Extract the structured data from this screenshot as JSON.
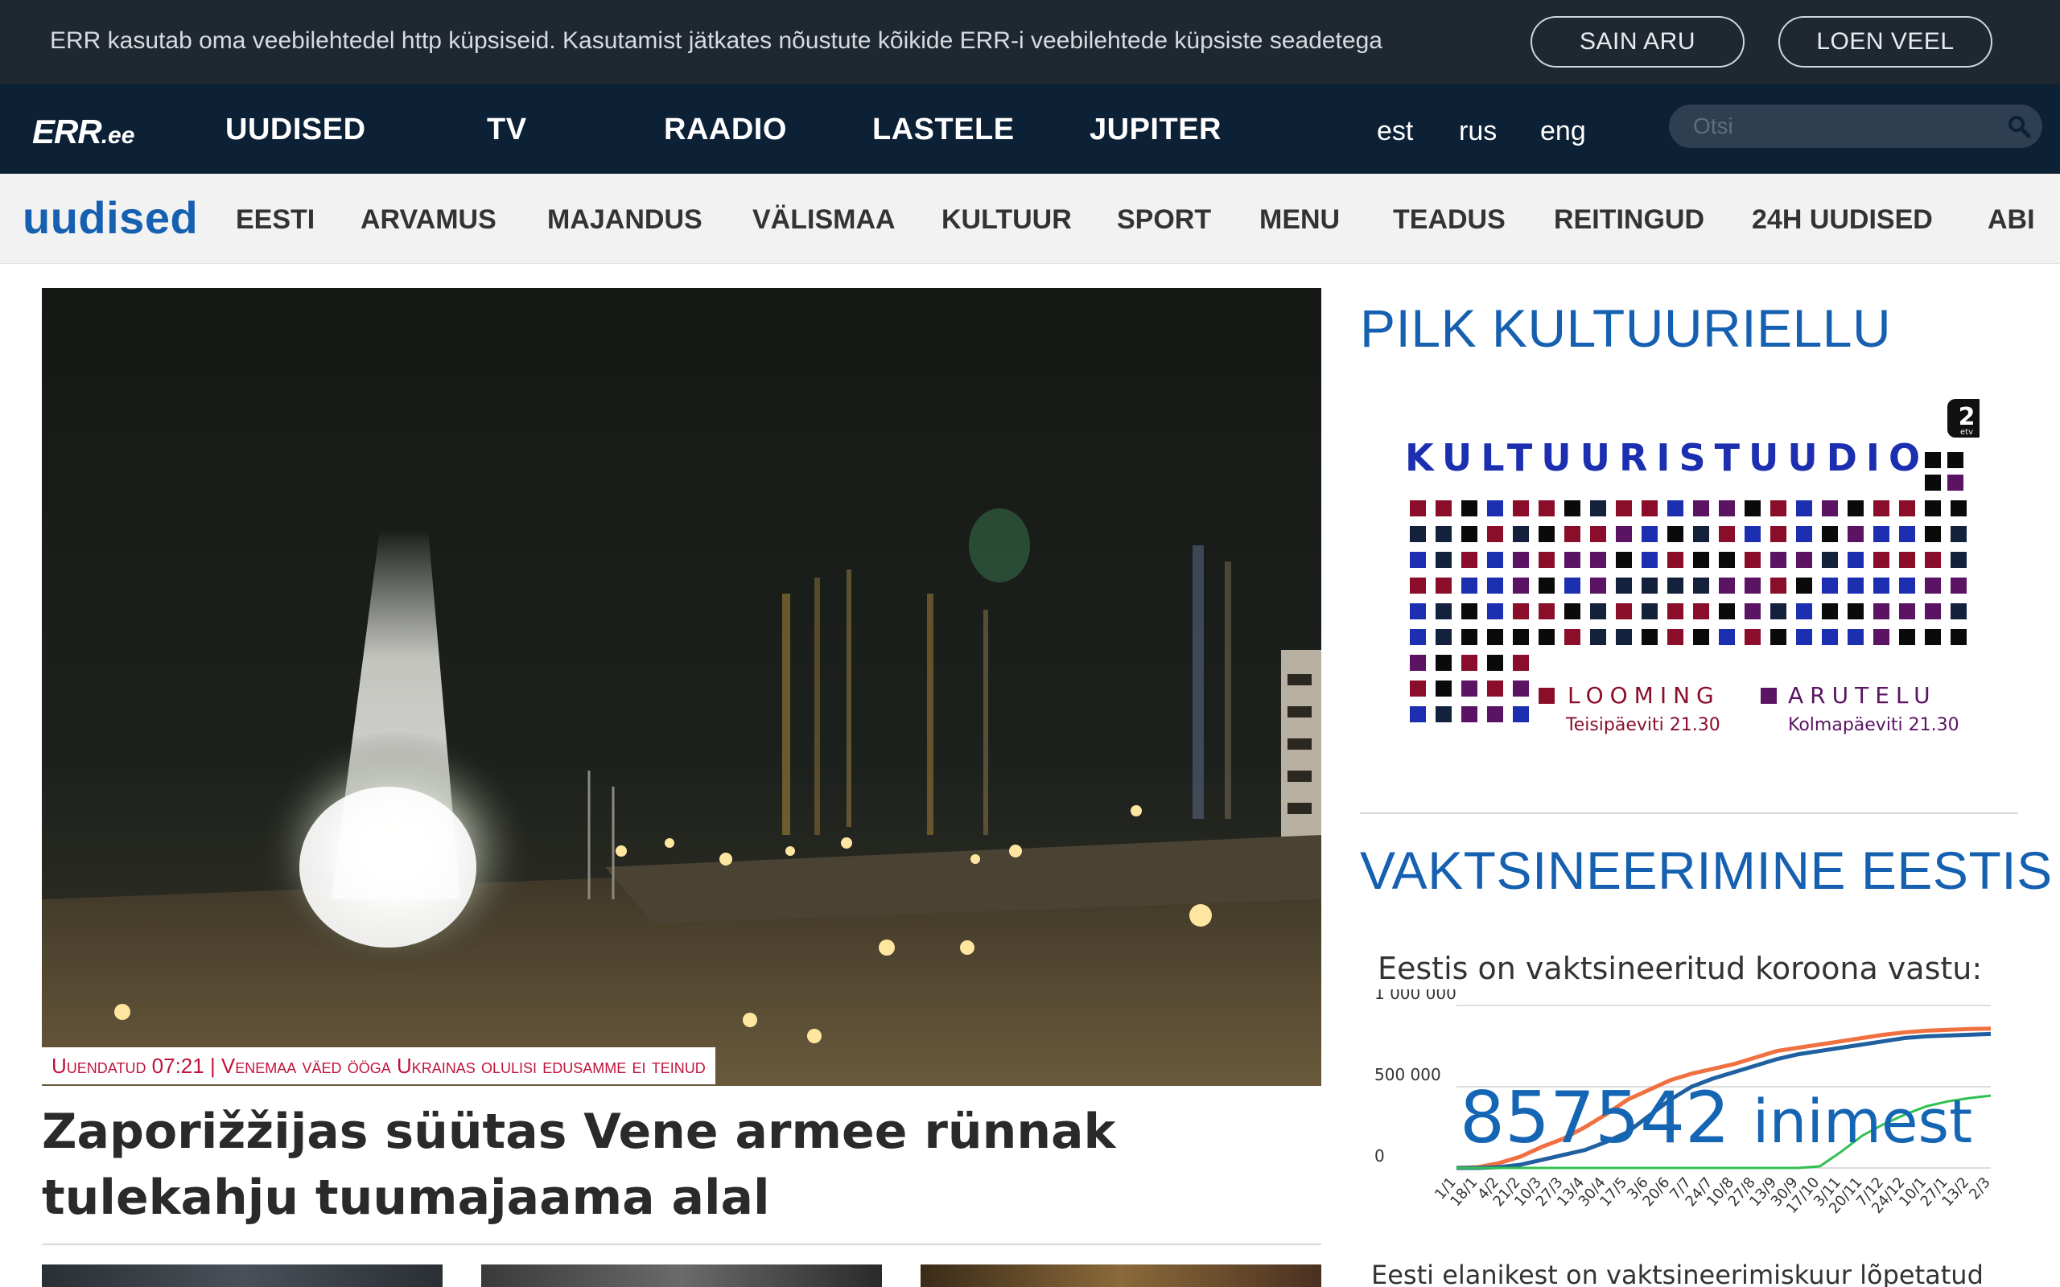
{
  "cookie_bar": {
    "text": "ERR kasutab oma veebilehtedel http küpsiseid. Kasutamist jätkates nõustute kõikide ERR-i veebilehtede küpsiste seadetega",
    "agree_label": "SAIN ARU",
    "more_label": "LOEN VEEL"
  },
  "topnav": {
    "logo_main": "ERR",
    "logo_tld": ".ee",
    "items": [
      "UUDISED",
      "TV",
      "RAADIO",
      "LASTELE",
      "JUPITER"
    ],
    "languages": [
      "est",
      "rus",
      "eng"
    ],
    "search_placeholder": "Otsi"
  },
  "section_nav": {
    "brand": "uudised",
    "items": [
      "EESTI",
      "ARVAMUS",
      "MAJANDUS",
      "VÄLISMAA",
      "KULTUUR",
      "SPORT",
      "MENU",
      "TEADUS",
      "REITINGUD",
      "24H UUDISED",
      "ABI"
    ]
  },
  "hero": {
    "caption": "Uuendatud 07:21 | Venemaa väed ööga Ukrainas olulisi edusamme ei teinud",
    "title": "Zaporižžijas süütas Vene armee rünnak tulekahju tuumajaama alal"
  },
  "sidebar": {
    "culture_heading": "PILK KULTUURIELLU",
    "promo": {
      "title": "KULTUURISTUUDIO",
      "channel": "2",
      "channel_sub": "etv",
      "left_label": "LOOMING",
      "left_time": "Teisipäeviti 21.30",
      "right_label": "ARUTELU",
      "right_time": "Kolmapäeviti 21.30",
      "colors": [
        "#0a0a0a",
        "#1b2fb0",
        "#8a0e2a",
        "#5a1463",
        "#14213d"
      ]
    },
    "vax_heading": "VAKTSINEERIMINE EESTIS",
    "vax_subheading": "Eestis on vaktsineeritud koroona vastu:",
    "vax_count": "857542",
    "vax_count_unit": "inimest",
    "vax_footer": "Eesti elanikest on vaktsineerimiskuur lõpetatud"
  },
  "chart_data": {
    "type": "line",
    "title": "",
    "xlabel": "",
    "ylabel": "",
    "yticks": [
      "1 000 000",
      "500 000",
      "0"
    ],
    "ylim": [
      0,
      1000000
    ],
    "x": [
      "1/1",
      "18/1",
      "4/2",
      "21/2",
      "10/3",
      "27/3",
      "13/4",
      "30/4",
      "17/5",
      "3/6",
      "20/6",
      "7/7",
      "24/7",
      "10/8",
      "27/8",
      "13/9",
      "30/9",
      "17/10",
      "3/11",
      "20/11",
      "7/12",
      "24/12",
      "10/1",
      "27/1",
      "13/2",
      "2/3"
    ],
    "series": [
      {
        "color": "#f07040",
        "values": [
          0,
          5000,
          30000,
          70000,
          130000,
          180000,
          250000,
          330000,
          420000,
          480000,
          540000,
          580000,
          610000,
          640000,
          680000,
          720000,
          740000,
          760000,
          780000,
          800000,
          820000,
          835000,
          845000,
          850000,
          855000,
          857542
        ]
      },
      {
        "color": "#2060a0",
        "values": [
          0,
          0,
          5000,
          20000,
          50000,
          80000,
          110000,
          160000,
          220000,
          320000,
          420000,
          500000,
          550000,
          590000,
          630000,
          670000,
          700000,
          720000,
          740000,
          760000,
          780000,
          800000,
          810000,
          815000,
          820000,
          825000
        ]
      },
      {
        "color": "#30c050",
        "values": [
          0,
          0,
          0,
          0,
          0,
          0,
          0,
          0,
          0,
          0,
          0,
          0,
          0,
          0,
          0,
          0,
          0,
          10000,
          100000,
          200000,
          270000,
          330000,
          380000,
          410000,
          430000,
          445000
        ]
      }
    ]
  }
}
